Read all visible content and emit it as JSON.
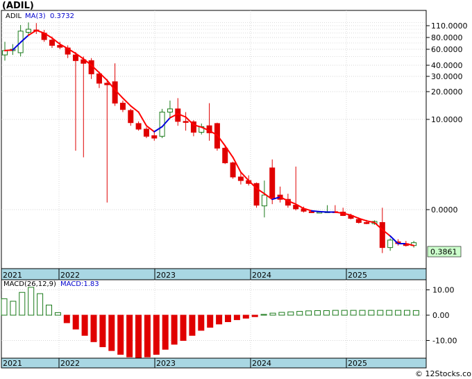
{
  "title": "(ADIL)",
  "copyright": "© 12Stocks.com",
  "colors": {
    "up": "#1a7a1a",
    "down": "#e00000",
    "ma_down": "#ff0000",
    "ma_up": "#0000dd",
    "axis_band": "#a9d7e3",
    "last_label_bg": "#ccffcc",
    "grid": "#c8c8c8"
  },
  "chart_data": [
    {
      "type": "candlestick",
      "legend": {
        "symbol": "ADIL",
        "ma_label": "MA(3)",
        "ma_value": "0.3732"
      },
      "scale": "log",
      "y_tick_labels": [
        "110.0000",
        "80.0000",
        "60.0000",
        "40.0000",
        "30.0000",
        "20.0000",
        "10.0000",
        "0.0000"
      ],
      "last_price_label": "0.3861",
      "x_tick_labels": [
        "2021",
        "2022",
        "2023",
        "2024",
        "2025"
      ],
      "ohlc": [
        [
          52,
          72,
          45,
          58
        ],
        [
          58,
          68,
          52,
          60
        ],
        [
          55,
          112,
          50,
          95
        ],
        [
          92,
          120,
          85,
          100
        ],
        [
          98,
          118,
          88,
          95
        ],
        [
          90,
          98,
          72,
          76
        ],
        [
          75,
          82,
          62,
          66
        ],
        [
          66,
          72,
          60,
          63
        ],
        [
          62,
          66,
          48,
          53
        ],
        [
          52,
          56,
          4.5,
          45
        ],
        [
          46,
          50,
          3.8,
          42
        ],
        [
          45,
          48,
          28,
          32
        ],
        [
          32,
          34,
          22,
          25
        ],
        [
          25,
          28,
          1.2,
          24
        ],
        [
          26,
          42,
          14,
          15
        ],
        [
          15,
          16,
          12,
          12.8
        ],
        [
          12.5,
          13,
          8.5,
          9.2
        ],
        [
          9,
          9.5,
          7.5,
          7.8
        ],
        [
          7.8,
          8.2,
          6.2,
          6.5
        ],
        [
          6.6,
          7.5,
          5.8,
          6.2
        ],
        [
          6.5,
          13,
          6.2,
          12
        ],
        [
          12,
          16,
          10.5,
          13
        ],
        [
          13,
          17,
          8.5,
          9.5
        ],
        [
          9.5,
          12,
          7.5,
          9.4
        ],
        [
          9.4,
          9.8,
          6.5,
          7.2
        ],
        [
          7.2,
          9,
          6.8,
          8.3
        ],
        [
          8.5,
          15,
          5.8,
          7.1
        ],
        [
          9,
          9.2,
          4.5,
          4.8
        ],
        [
          4.8,
          5.2,
          3.2,
          3.3
        ],
        [
          3.3,
          3.4,
          2.2,
          2.3
        ],
        [
          2.3,
          2.6,
          1.9,
          2.1
        ],
        [
          2.1,
          2.4,
          1.85,
          1.95
        ],
        [
          1.95,
          2.0,
          1.05,
          1.12
        ],
        [
          1.1,
          2.1,
          0.82,
          1.45
        ],
        [
          2.9,
          3.6,
          1.15,
          1.35
        ],
        [
          1.45,
          1.8,
          1.2,
          1.3
        ],
        [
          1.3,
          1.5,
          1.05,
          1.12
        ],
        [
          1.12,
          3.0,
          0.98,
          1.02
        ],
        [
          1.02,
          1.08,
          0.93,
          0.96
        ],
        [
          0.95,
          0.99,
          0.92,
          0.93
        ],
        [
          0.93,
          0.96,
          0.92,
          0.94
        ],
        [
          0.94,
          1.12,
          0.93,
          0.95
        ],
        [
          0.95,
          1.12,
          0.94,
          0.94
        ],
        [
          0.94,
          1.05,
          0.85,
          0.86
        ],
        [
          0.86,
          0.9,
          0.78,
          0.8
        ],
        [
          0.78,
          0.82,
          0.7,
          0.72
        ],
        [
          0.72,
          0.77,
          0.69,
          0.7
        ],
        [
          0.7,
          0.76,
          0.68,
          0.74
        ],
        [
          0.72,
          1.05,
          0.33,
          0.38
        ],
        [
          0.38,
          0.48,
          0.35,
          0.46
        ],
        [
          0.44,
          0.47,
          0.4,
          0.42
        ],
        [
          0.42,
          0.45,
          0.39,
          0.4
        ],
        [
          0.4,
          0.45,
          0.38,
          0.43
        ]
      ],
      "ma3": [
        58,
        59,
        71,
        85,
        97,
        90,
        79,
        68,
        61,
        54,
        47,
        40,
        33,
        27,
        21,
        17,
        14,
        12,
        8.5,
        7.3,
        8.3,
        10.4,
        11.5,
        10.6,
        8.7,
        8.2,
        7.5,
        6.7,
        5.1,
        3.8,
        2.6,
        2.1,
        1.72,
        1.5,
        1.3,
        1.38,
        1.25,
        1.15,
        1.03,
        0.97,
        0.95,
        0.94,
        0.94,
        0.91,
        0.87,
        0.8,
        0.75,
        0.72,
        0.6,
        0.51,
        0.42,
        0.42,
        0.4
      ],
      "ma3_color": [
        "d",
        "d",
        "u",
        "u",
        "d",
        "d",
        "d",
        "d",
        "d",
        "d",
        "d",
        "d",
        "d",
        "d",
        "d",
        "d",
        "d",
        "d",
        "d",
        "d",
        "u",
        "u",
        "d",
        "d",
        "d",
        "d",
        "d",
        "d",
        "d",
        "d",
        "d",
        "d",
        "d",
        "d",
        "d",
        "u",
        "d",
        "d",
        "d",
        "d",
        "u",
        "u",
        "u",
        "d",
        "d",
        "d",
        "d",
        "d",
        "d",
        "d",
        "u",
        "u",
        "d"
      ]
    },
    {
      "type": "bar",
      "legend": {
        "label": "MACD(26,12,9)",
        "value_label": "MACD:1.83"
      },
      "y_tick_labels": [
        "10.00",
        "0.00",
        "-10.00"
      ],
      "ylim": [
        -17,
        14
      ],
      "x_tick_labels": [
        "2021",
        "2022",
        "2023",
        "2024",
        "2025"
      ],
      "values": [
        6.5,
        5.5,
        9,
        11,
        8.5,
        4,
        1,
        -3,
        -5.5,
        -8,
        -10.5,
        -12.5,
        -14,
        -15.5,
        -16.5,
        -17,
        -16.5,
        -15.5,
        -13.5,
        -11.5,
        -10,
        -8,
        -6,
        -4.8,
        -3.5,
        -2.6,
        -1.8,
        -1.2,
        -0.6,
        0.3,
        0.8,
        1.1,
        1.3,
        1.5,
        1.7,
        1.8,
        1.8,
        1.9,
        1.9,
        1.9,
        1.9,
        1.9,
        1.9,
        1.9,
        1.9,
        1.9,
        1.83
      ]
    }
  ]
}
